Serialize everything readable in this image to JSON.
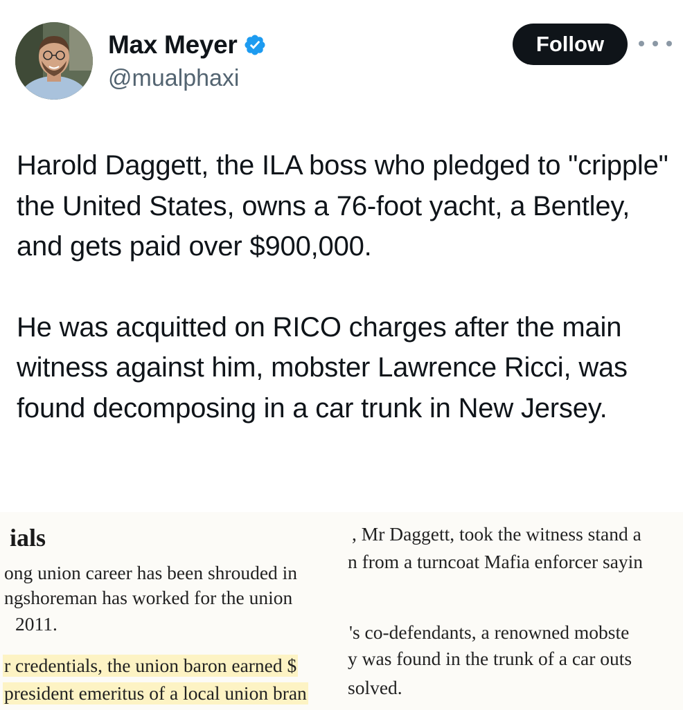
{
  "author": {
    "name": "Max Meyer",
    "handle": "@mualphaxi",
    "verified": true,
    "avatar_icon": "profile-photo",
    "verified_icon": "verified-badge-icon",
    "verified_color": "#1d9bf0"
  },
  "actions": {
    "follow_label": "Follow",
    "more_icon": "more-options-icon"
  },
  "tweet": {
    "paragraphs": [
      "Harold Daggett, the ILA boss who pledged to \"cripple\" the United States, owns a 76-foot yacht, a Bentley, and gets paid over $900,000.",
      "He was acquitted on RICO charges after the main witness against him, mobster Lawrence Ricci, was found decomposing in a car trunk in New Jersey."
    ]
  },
  "clipping": {
    "left_column": {
      "heading": "ials",
      "lines": [
        "ong union career has been shrouded in",
        "ngshoreman has worked for the union",
        "2011.",
        "r credentials, the union baron earned $",
        "president emeritus of a local union bran"
      ]
    },
    "right_column": {
      "lines": [
        ", Mr Daggett, took the witness stand a",
        "n from a turncoat Mafia enforcer sayin",
        "'s co-defendants, a renowned mobste",
        "y was found in the trunk of a car outs",
        "solved."
      ]
    },
    "highlight_color": "#fdf3c4"
  }
}
